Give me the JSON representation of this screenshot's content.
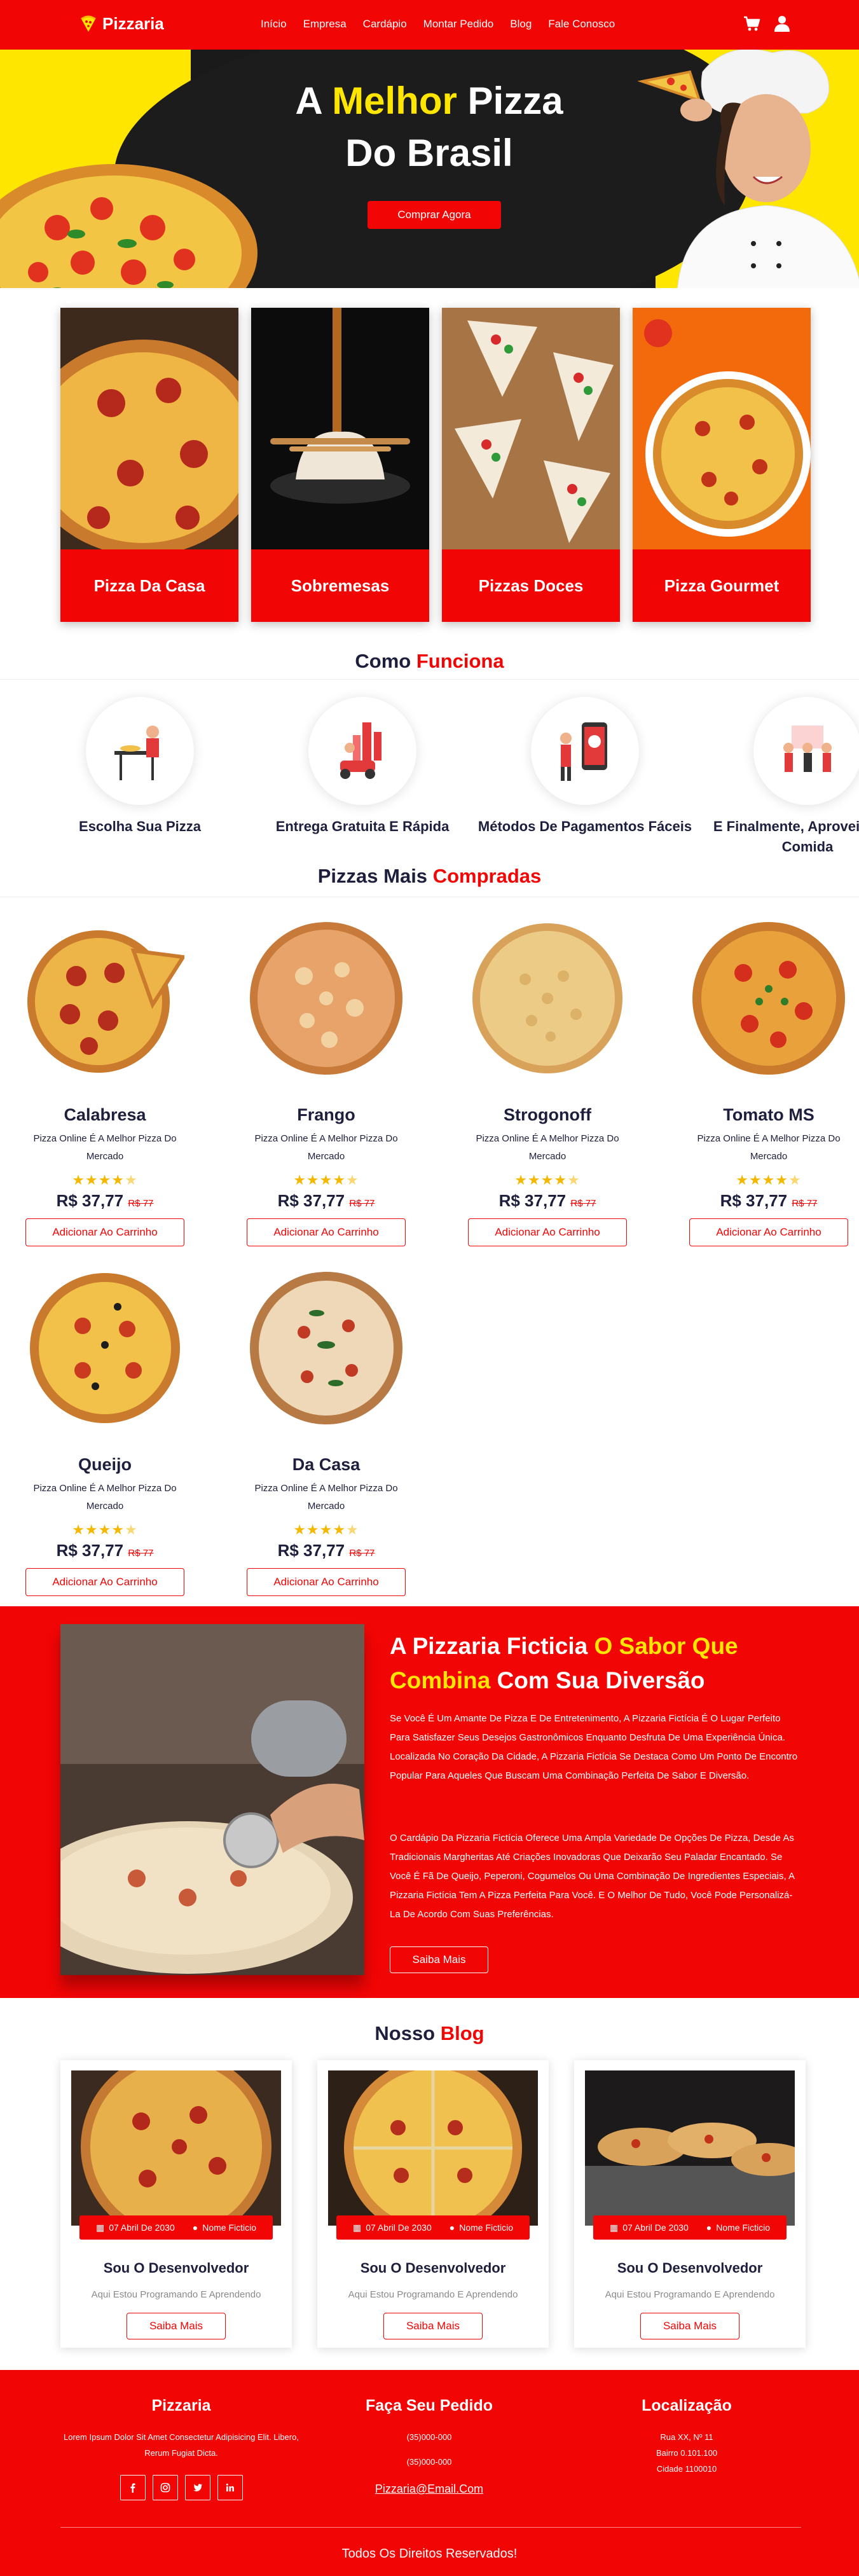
{
  "header": {
    "brand": "Pizzaria",
    "nav": [
      "Início",
      "Empresa",
      "Cardápio",
      "Montar Pedido",
      "Blog",
      "Fale Conosco"
    ],
    "icons": [
      "cart-icon",
      "user-icon"
    ]
  },
  "hero": {
    "title_part1": "A ",
    "title_highlight": "Melhor",
    "title_part2": " Pizza",
    "title_line2": "Do Brasil",
    "cta": "Comprar Agora"
  },
  "categories": [
    "Pizza Da Casa",
    "Sobremesas",
    "Pizzas Doces",
    "Pizza Gourmet"
  ],
  "how": {
    "title": "Como",
    "title_accent": "Funciona",
    "steps": [
      "Escolha Sua Pizza",
      "Entrega Gratuita E Rápida",
      "Métodos De Pagamentos Fáceis",
      "E Finalmente, Aproveite Sua Comida"
    ]
  },
  "products": {
    "title": "Pizzas Mais",
    "title_accent": "Compradas",
    "items": [
      {
        "name": "Calabresa",
        "desc": "Pizza Online É A Melhor Pizza Do Mercado",
        "price": "R$ 37,77",
        "old_price": "R$ 77",
        "rating": 4.5,
        "button": "Adicionar Ao Carrinho"
      },
      {
        "name": "Frango",
        "desc": "Pizza Online É A Melhor Pizza Do Mercado",
        "price": "R$ 37,77",
        "old_price": "R$ 77",
        "rating": 4.5,
        "button": "Adicionar Ao Carrinho"
      },
      {
        "name": "Strogonoff",
        "desc": "Pizza Online É A Melhor Pizza Do Mercado",
        "price": "R$ 37,77",
        "old_price": "R$ 77",
        "rating": 4.5,
        "button": "Adicionar Ao Carrinho"
      },
      {
        "name": "Tomato MS",
        "desc": "Pizza Online É A Melhor Pizza Do Mercado",
        "price": "R$ 37,77",
        "old_price": "R$ 77",
        "rating": 4.5,
        "button": "Adicionar Ao Carrinho"
      },
      {
        "name": "Queijo",
        "desc": "Pizza Online É A Melhor Pizza Do Mercado",
        "price": "R$ 37,77",
        "old_price": "R$ 77",
        "rating": 4.5,
        "button": "Adicionar Ao Carrinho"
      },
      {
        "name": "Da Casa",
        "desc": "Pizza Online É A Melhor Pizza Do Mercado",
        "price": "R$ 37,77",
        "old_price": "R$ 77",
        "rating": 4.5,
        "button": "Adicionar Ao Carrinho"
      }
    ]
  },
  "about": {
    "title_part1": "A Pizzaria Ficticia ",
    "title_highlight": "O Sabor Que Combina",
    "title_part2": " Com Sua Diversão",
    "p1": "Se Você É Um Amante De Pizza E De Entretenimento, A Pizzaria Fictícia É O Lugar Perfeito Para Satisfazer Seus Desejos Gastronômicos Enquanto Desfruta De Uma Experiência Única. Localizada No Coração Da Cidade, A Pizzaria Fictícia Se Destaca Como Um Ponto De Encontro Popular Para Aqueles Que Buscam Uma Combinação Perfeita De Sabor E Diversão.",
    "p2": "O Cardápio Da Pizzaria Fictícia Oferece Uma Ampla Variedade De Opções De Pizza, Desde As Tradicionais Margheritas Até Criações Inovadoras Que Deixarão Seu Paladar Encantado. Se Você É Fã De Queijo, Peperoni, Cogumelos Ou Uma Combinação De Ingredientes Especiais, A Pizzaria Fictícia Tem A Pizza Perfeita Para Você. E O Melhor De Tudo, Você Pode Personalizá-La De Acordo Com Suas Preferências.",
    "button": "Saiba Mais"
  },
  "blog": {
    "title": "Nosso",
    "title_accent": "Blog",
    "posts": [
      {
        "date": "07 Abril De 2030",
        "author": "Nome Ficticio",
        "title": "Sou O Desenvolvedor",
        "sub": "Aqui Estou Programando E Aprendendo",
        "button": "Saiba Mais"
      },
      {
        "date": "07 Abril De 2030",
        "author": "Nome Ficticio",
        "title": "Sou O Desenvolvedor",
        "sub": "Aqui Estou Programando E Aprendendo",
        "button": "Saiba Mais"
      },
      {
        "date": "07 Abril De 2030",
        "author": "Nome Ficticio",
        "title": "Sou O Desenvolvedor",
        "sub": "Aqui Estou Programando E Aprendendo",
        "button": "Saiba Mais"
      }
    ]
  },
  "footer": {
    "col1_title": "Pizzaria",
    "col1_text": "Lorem Ipsum Dolor Sit Amet Consectetur Adipisicing Elit. Libero, Rerum Fugiat Dicta.",
    "col2_title": "Faça Seu Pedido",
    "phone1": "(35)000-000",
    "phone2": "(35)000-000",
    "email": "Pizzaria@Email.Com",
    "col3_title": "Localização",
    "address1": "Rua XX, Nº 11",
    "address2": "Bairro 0.101.100",
    "address3": "Cidade 1100010",
    "socials": [
      "facebook-icon",
      "instagram-icon",
      "twitter-icon",
      "linkedin-icon"
    ],
    "copyright": "Todos Os Direitos Reservados!"
  },
  "colors": {
    "primary": "#f20505",
    "accent": "#ffe600",
    "dark": "#1d1f3d",
    "star": "#f5b800"
  }
}
